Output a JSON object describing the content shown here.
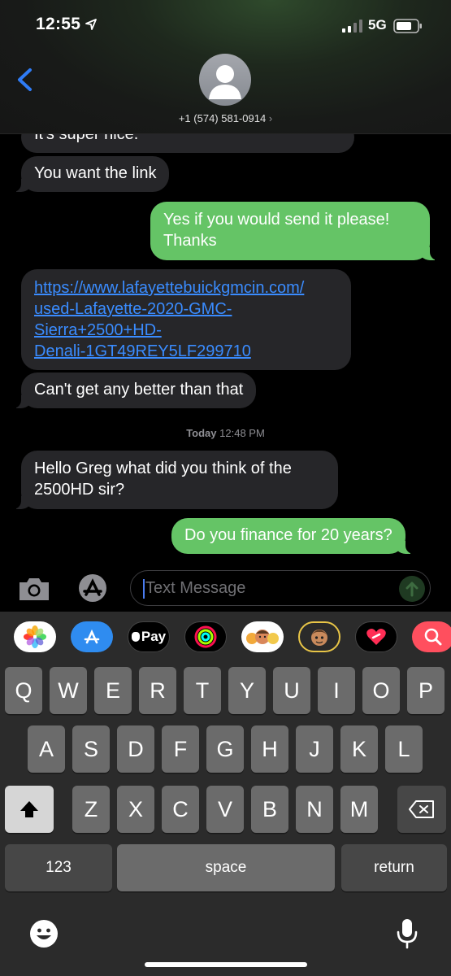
{
  "status_bar": {
    "time": "12:55",
    "network": "5G"
  },
  "header": {
    "contact": "+1 (574) 581-0914",
    "back_icon": "chevron-left-icon",
    "avatar_icon": "person-silhouette-icon"
  },
  "messages": [
    {
      "direction": "incoming",
      "text": "It's super nice."
    },
    {
      "direction": "incoming",
      "text": "You want the link"
    },
    {
      "direction": "outgoing",
      "lines": [
        "Yes if you would send it please!",
        "Thanks"
      ]
    },
    {
      "direction": "incoming",
      "type": "link",
      "lines": [
        "https://www.lafayettebuickgmcin.com/",
        "used-Lafayette-2020-GMC-",
        "Sierra+2500+HD-",
        "Denali-1GT49REY5LF299710"
      ]
    },
    {
      "direction": "incoming",
      "text": "Can't get any better than that"
    },
    {
      "direction": "incoming",
      "lines": [
        "Hello Greg what did you think of the",
        "2500HD sir?"
      ]
    },
    {
      "direction": "outgoing",
      "text": "Do you finance for 20 years?"
    }
  ],
  "timestamp": {
    "date": "Today",
    "time": "12:48 PM"
  },
  "input": {
    "placeholder": "Text Message",
    "camera_icon": "camera-icon",
    "apps_icon": "app-store-icon",
    "send_icon": "send-arrow-icon"
  },
  "app_strip": [
    {
      "name": "Photos",
      "icon": "photos-icon"
    },
    {
      "name": "App Store",
      "icon": "app-store-icon"
    },
    {
      "name": "Apple Pay",
      "label": "Pay",
      "icon": "apple-pay-icon"
    },
    {
      "name": "Activity",
      "icon": "activity-rings-icon"
    },
    {
      "name": "Memoji Stickers",
      "icon": "memoji-stickers-icon"
    },
    {
      "name": "Animoji",
      "icon": "animoji-icon"
    },
    {
      "name": "Digital Touch",
      "icon": "digital-touch-icon"
    },
    {
      "name": "Images",
      "icon": "image-search-icon"
    }
  ],
  "keyboard": {
    "row1": [
      "Q",
      "W",
      "E",
      "R",
      "T",
      "Y",
      "U",
      "I",
      "O",
      "P"
    ],
    "row2": [
      "A",
      "S",
      "D",
      "F",
      "G",
      "H",
      "J",
      "K",
      "L"
    ],
    "row3": [
      "Z",
      "X",
      "C",
      "V",
      "B",
      "N",
      "M"
    ],
    "numbers_label": "123",
    "space_label": "space",
    "return_label": "return",
    "shift_icon": "shift-icon",
    "delete_icon": "delete-icon",
    "emoji_icon": "emoji-icon",
    "mic_icon": "microphone-icon"
  },
  "colors": {
    "outgoing_bubble": "#65c466",
    "incoming_bubble": "#262629",
    "link": "#3a8cff",
    "accent_blue": "#2f7cf6"
  }
}
